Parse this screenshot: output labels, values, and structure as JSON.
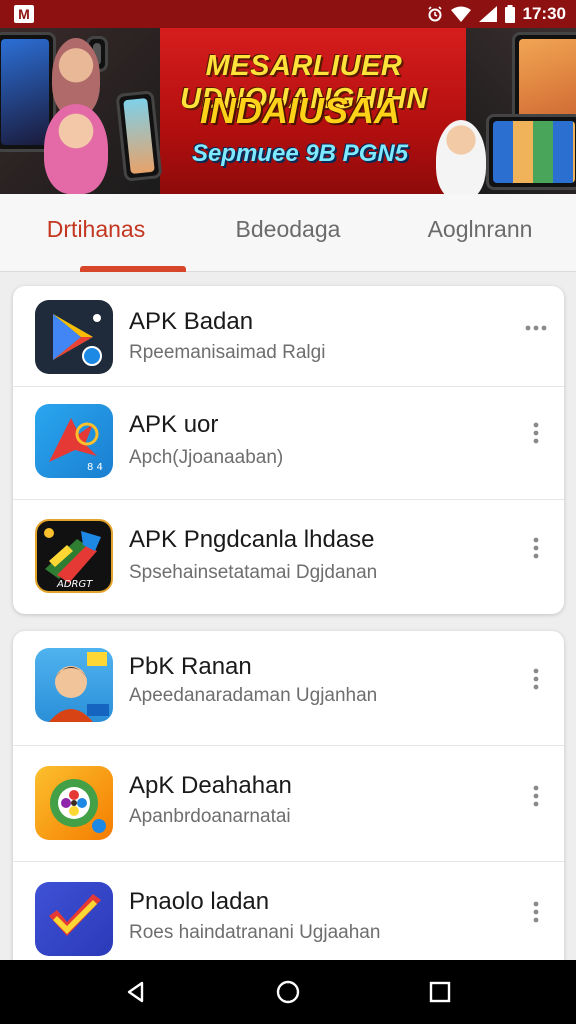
{
  "status_bar": {
    "time": "17:30",
    "icons": [
      "notification-icon",
      "alarm-icon",
      "wifi-icon",
      "signal-icon",
      "battery-icon"
    ]
  },
  "banner": {
    "headline": "MESARLIUER UDNOUANGHIHN",
    "subheadline": "INDAIUSAA",
    "tagline": "Sepmuee 9B PGN5"
  },
  "tabs": [
    {
      "label": "Drtihanas",
      "active": true
    },
    {
      "label": "Bdeodaga",
      "active": false
    },
    {
      "label": "Aoglnrann",
      "active": false
    }
  ],
  "apps": [
    {
      "title": "APK Badan",
      "description": "Rpeemanisaimad Ralgi",
      "icon": "play-store-icon",
      "more": "horizontal-dots-icon"
    },
    {
      "title": "APK uor",
      "description": "Apch(Jjoanaaban)",
      "icon": "red-arrow-app-icon",
      "more": "vertical-dots-icon"
    },
    {
      "title": "APK Pngdcanla lhdase",
      "description": "Spsehainsetatamai Dgjdanan",
      "icon": "colorful-brush-app-icon",
      "more": "vertical-dots-icon"
    },
    {
      "title": "PbK Ranan",
      "description": "Apeedanaradaman Ugjanhan",
      "icon": "avatar-app-icon",
      "more": "vertical-dots-icon"
    },
    {
      "title": "ApK Deahahan",
      "description": "Apanbrdoanarnatai",
      "icon": "flower-app-icon",
      "more": "vertical-dots-icon"
    },
    {
      "title": "Pnaolo ladan",
      "description": "Roes haindatranani Ugjaahan",
      "icon": "checkmark-app-icon",
      "more": "vertical-dots-icon"
    }
  ],
  "nav": [
    "back-icon",
    "home-icon",
    "recents-icon"
  ],
  "colors": {
    "status_bar": "#8e1111",
    "accent": "#d8462a",
    "banner_red": "#c41616"
  }
}
